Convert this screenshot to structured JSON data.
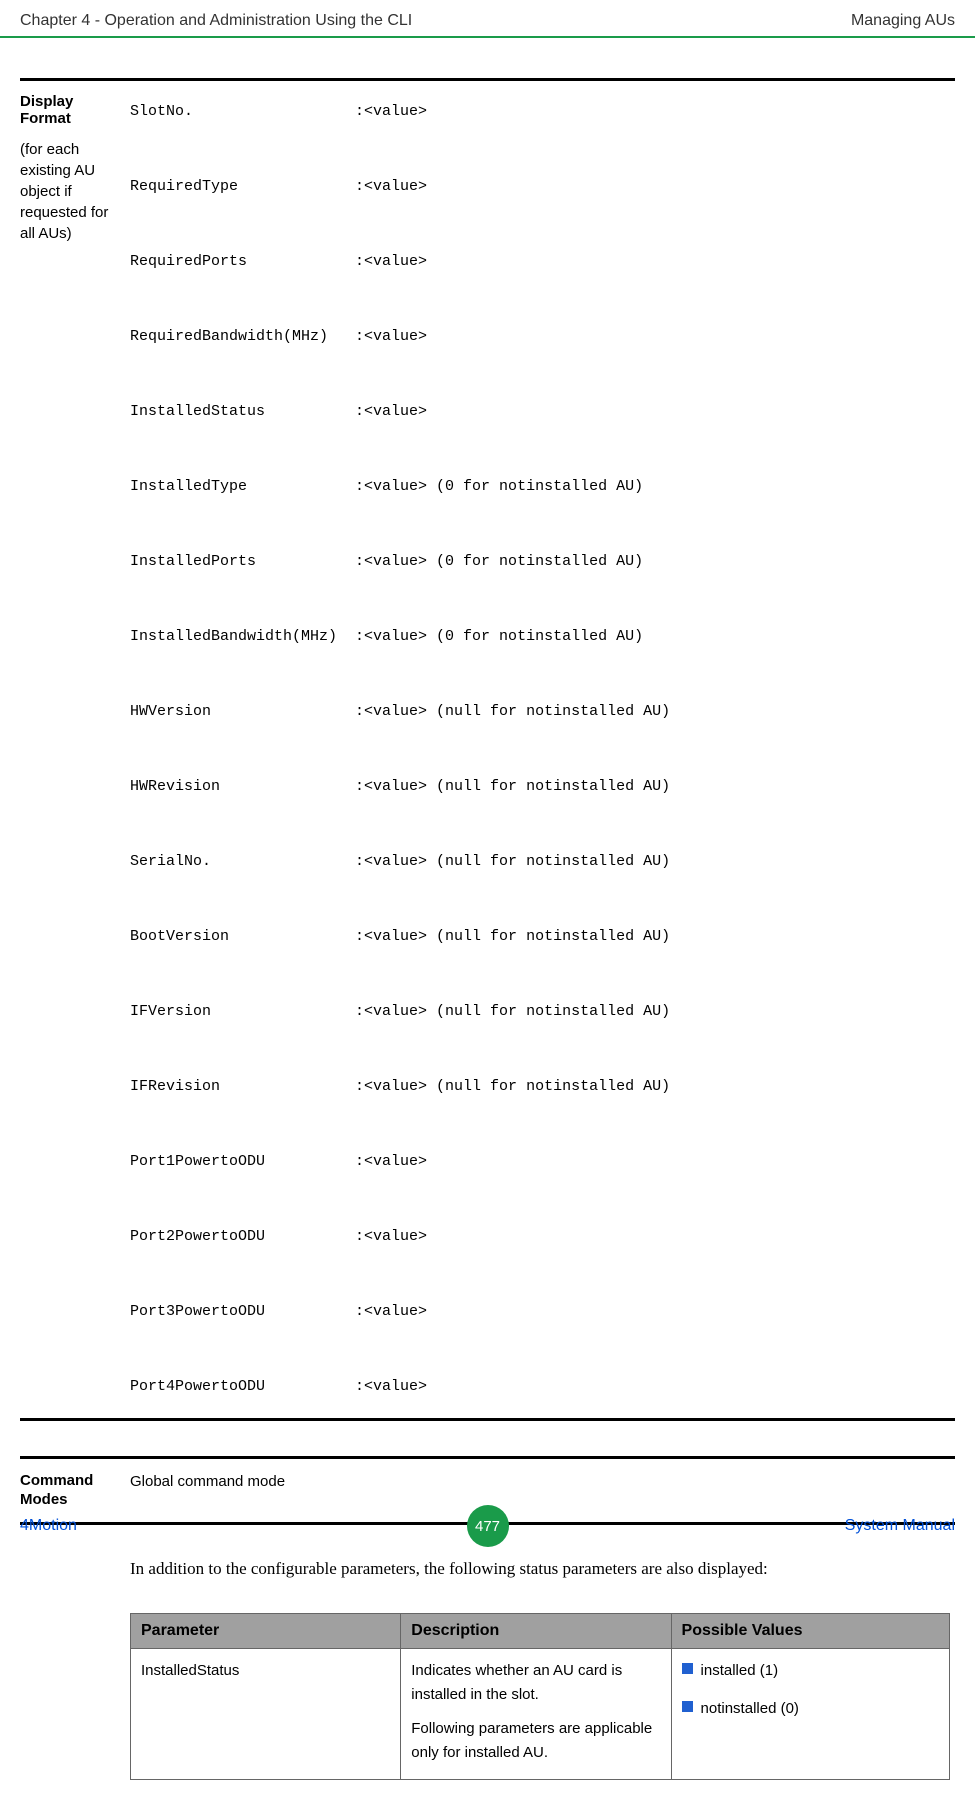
{
  "header": {
    "left": "Chapter 4 - Operation and Administration Using the CLI",
    "right": "Managing AUs"
  },
  "display": {
    "label_bold": "Display Format",
    "label_sub": "(for each existing AU object if requested for all AUs)",
    "lines": "SlotNo.                  :<value>\n\nRequiredType             :<value>\n\nRequiredPorts            :<value>\n\nRequiredBandwidth(MHz)   :<value>\n\nInstalledStatus          :<value>\n\nInstalledType            :<value> (0 for notinstalled AU)\n\nInstalledPorts           :<value> (0 for notinstalled AU)\n\nInstalledBandwidth(MHz)  :<value> (0 for notinstalled AU)\n\nHWVersion                :<value> (null for notinstalled AU)\n\nHWRevision               :<value> (null for notinstalled AU)\n\nSerialNo.                :<value> (null for notinstalled AU)\n\nBootVersion              :<value> (null for notinstalled AU)\n\nIFVersion                :<value> (null for notinstalled AU)\n\nIFRevision               :<value> (null for notinstalled AU)\n\nPort1PowertoODU          :<value>\n\nPort2PowertoODU          :<value>\n\nPort3PowertoODU          :<value>\n\nPort4PowertoODU          :<value>"
  },
  "command": {
    "label": "Command Modes",
    "content": "Global command mode"
  },
  "body_text": "In addition to the configurable parameters, the following status parameters are also displayed:",
  "table": {
    "headers": {
      "parameter": "Parameter",
      "description": "Description",
      "possible_values": "Possible Values"
    },
    "rows": [
      {
        "parameter": "InstalledStatus",
        "description_p1": "Indicates whether an AU card is installed in the slot.",
        "description_p2": "Following parameters are applicable only for installed AU.",
        "values": [
          "installed (1)",
          "notinstalled (0)"
        ]
      }
    ]
  },
  "footer": {
    "left": "4Motion",
    "center": "477",
    "right": "System Manual"
  }
}
